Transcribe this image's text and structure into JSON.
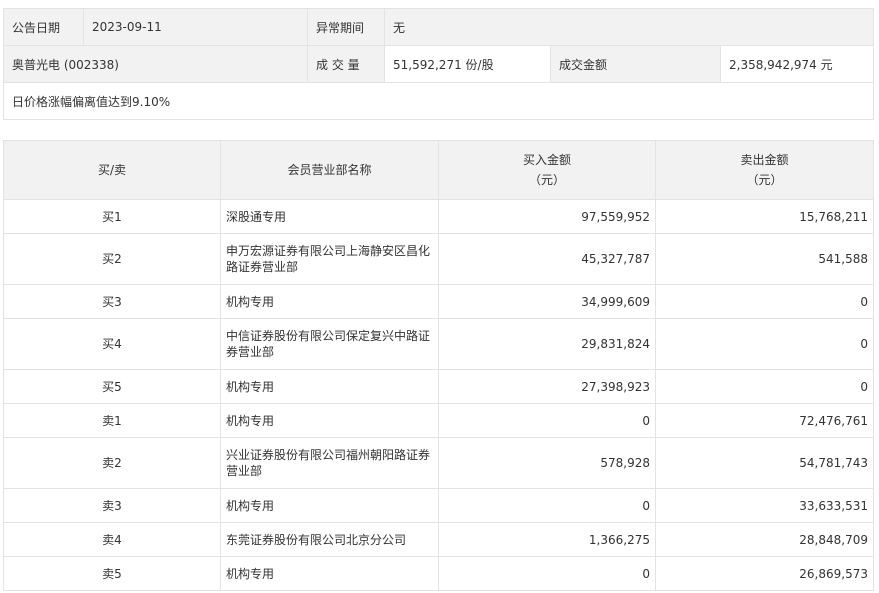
{
  "summary": {
    "date_label": "公告日期",
    "date_value": "2023-09-11",
    "period_label": "异常期间",
    "period_value": "无",
    "stock": "奥普光电 (002338)",
    "volume_label": "成 交 量",
    "volume_value": "51,592,271 份/股",
    "amount_label": "成交金额",
    "amount_value": "2,358,942,974 元",
    "note": "日价格涨幅偏离值达到9.10%"
  },
  "detail": {
    "headers": {
      "side": "买/卖",
      "branch": "会员营业部名称",
      "buy_amount": "买入金额",
      "buy_unit": "（元）",
      "sell_amount": "卖出金额",
      "sell_unit": "（元）"
    },
    "rows": [
      {
        "side": "买1",
        "branch": "深股通专用",
        "buy": "97,559,952",
        "sell": "15,768,211"
      },
      {
        "side": "买2",
        "branch": "申万宏源证券有限公司上海静安区昌化路证券营业部",
        "buy": "45,327,787",
        "sell": "541,588"
      },
      {
        "side": "买3",
        "branch": "机构专用",
        "buy": "34,999,609",
        "sell": "0"
      },
      {
        "side": "买4",
        "branch": "中信证券股份有限公司保定复兴中路证券营业部",
        "buy": "29,831,824",
        "sell": "0"
      },
      {
        "side": "买5",
        "branch": "机构专用",
        "buy": "27,398,923",
        "sell": "0"
      },
      {
        "side": "卖1",
        "branch": "机构专用",
        "buy": "0",
        "sell": "72,476,761"
      },
      {
        "side": "卖2",
        "branch": "兴业证券股份有限公司福州朝阳路证券营业部",
        "buy": "578,928",
        "sell": "54,781,743"
      },
      {
        "side": "卖3",
        "branch": "机构专用",
        "buy": "0",
        "sell": "33,633,531"
      },
      {
        "side": "卖4",
        "branch": "东莞证券股份有限公司北京分公司",
        "buy": "1,366,275",
        "sell": "28,848,709"
      },
      {
        "side": "卖5",
        "branch": "机构专用",
        "buy": "0",
        "sell": "26,869,573"
      }
    ]
  }
}
